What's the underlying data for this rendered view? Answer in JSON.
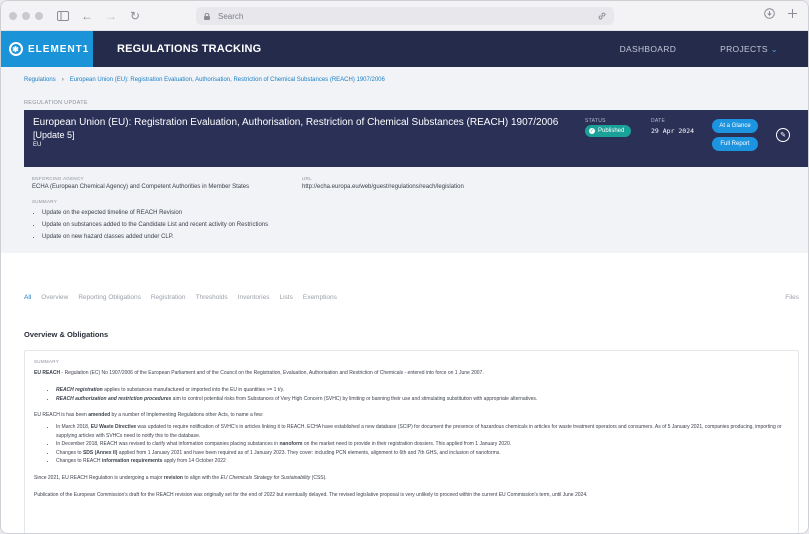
{
  "browser": {
    "search_placeholder": "Search"
  },
  "app": {
    "logo_text": "ELEMENT1",
    "title": "REGULATIONS TRACKING",
    "nav": [
      "DASHBOARD",
      "PROJECTS"
    ]
  },
  "breadcrumb": {
    "root": "Regulations",
    "current": "European Union (EU): Registration Evaluation, Authorisation, Restriction of Chemical Substances (REACH) 1907/2006"
  },
  "section_label": "REGULATION UPDATE",
  "banner": {
    "title": "European Union (EU): Registration Evaluation, Authorisation, Restriction of Chemical Substances (REACH) 1907/2006",
    "subtitle": "[Update 5]",
    "country": "EU",
    "status_label": "STATUS",
    "status": "Published",
    "date_label": "DATE",
    "date": "29 Apr 2024",
    "glance_button": "At a Glance",
    "report_button": "Full Report"
  },
  "meta": {
    "agency_label": "ENFORCING AGENCY",
    "agency": "ECHA (European Chemical Agency) and Competent Authorities in Member States",
    "url_label": "URL",
    "url": "http://echa.europa.eu/web/guest/regulations/reach/legislation"
  },
  "summary": {
    "label": "SUMMARY",
    "items": [
      "Update on the expected timeline of REACH Revision",
      "Update on substances added to the Candidate List and recent activity on Restrictions",
      "Update on new hazard classes added under CLP."
    ]
  },
  "tabs": [
    "All",
    "Overview",
    "Reporting Obligations",
    "Registration",
    "Thresholds",
    "Inventories",
    "Lists",
    "Exemptions"
  ],
  "tab_files": "Files",
  "overview": {
    "title": "Overview & Obligations",
    "summary_label": "SUMMARY",
    "intro_bold": "EU REACH",
    "intro": " - Regulation (EC) No 1907/2006 of the European Parliament and of the Council on the Registration, Evaluation, Authorisation and Restriction of Chemicals - entered into force on 1 June 2007.",
    "bullets1": [
      {
        "bold": "REACH registration",
        "text": " applies to substances manufactured or imported into the EU in quantities >= 1 t/y."
      },
      {
        "bold": "REACH authorization and restriction procedures",
        "text": " aim to control potential risks from Substances of Very High Concern (SVHC) by limiting or banning their use and stimulating substitution with appropriate alternatives."
      }
    ],
    "amended_pre": "EU REACH is has been ",
    "amended_bold": "amended",
    "amended_post": " by a number of Implementing Regulations other Acts, to name a few:",
    "bullets2": [
      {
        "pre": "In March 2018, ",
        "bold": "EU Waste Directive",
        "text": " was updated to require notification of SVHC's in articles linking it to REACH. ECHA have established a new database (SCIP) for document the presence of hazardous chemicals in articles for waste treatment operators and consumers. As of 5 January 2021, companies producing, importing or supplying articles with SVHCs need to notify this to the database."
      },
      {
        "pre": "In December 2018, REACH was revised to clarify what information companies placing substances in ",
        "bold": "nanoform",
        "text": " on the market need to provide in their registration dossiers. This applied from 1 January 2020."
      },
      {
        "pre": "Changes to ",
        "bold": "SDS (Annex II)",
        "text": " applied from 1 January 2021 and have been required as of 1 January 2023. They cover: including PCN elements, alignment to 6th and 7th GHS, and inclusion of nanoforms."
      },
      {
        "pre": "Changes to REACH ",
        "bold": "information requirements",
        "text": " apply from 14 October 2022"
      }
    ],
    "revision_pre": "Since 2021, EU REACH Regulation is undergoing a major ",
    "revision_bold": "revision",
    "revision_mid": " to align with the ",
    "revision_italic": "EU Chemicals Strategy for Sustainability",
    "revision_post": " (CSS).",
    "last_line": "Publication of the European Commission's draft for the REACH revision was originally set for the end of 2022 but eventually delayed. The revised legislative proposal is very unlikely to proceed within the current EU Commission's term, until June 2024."
  }
}
